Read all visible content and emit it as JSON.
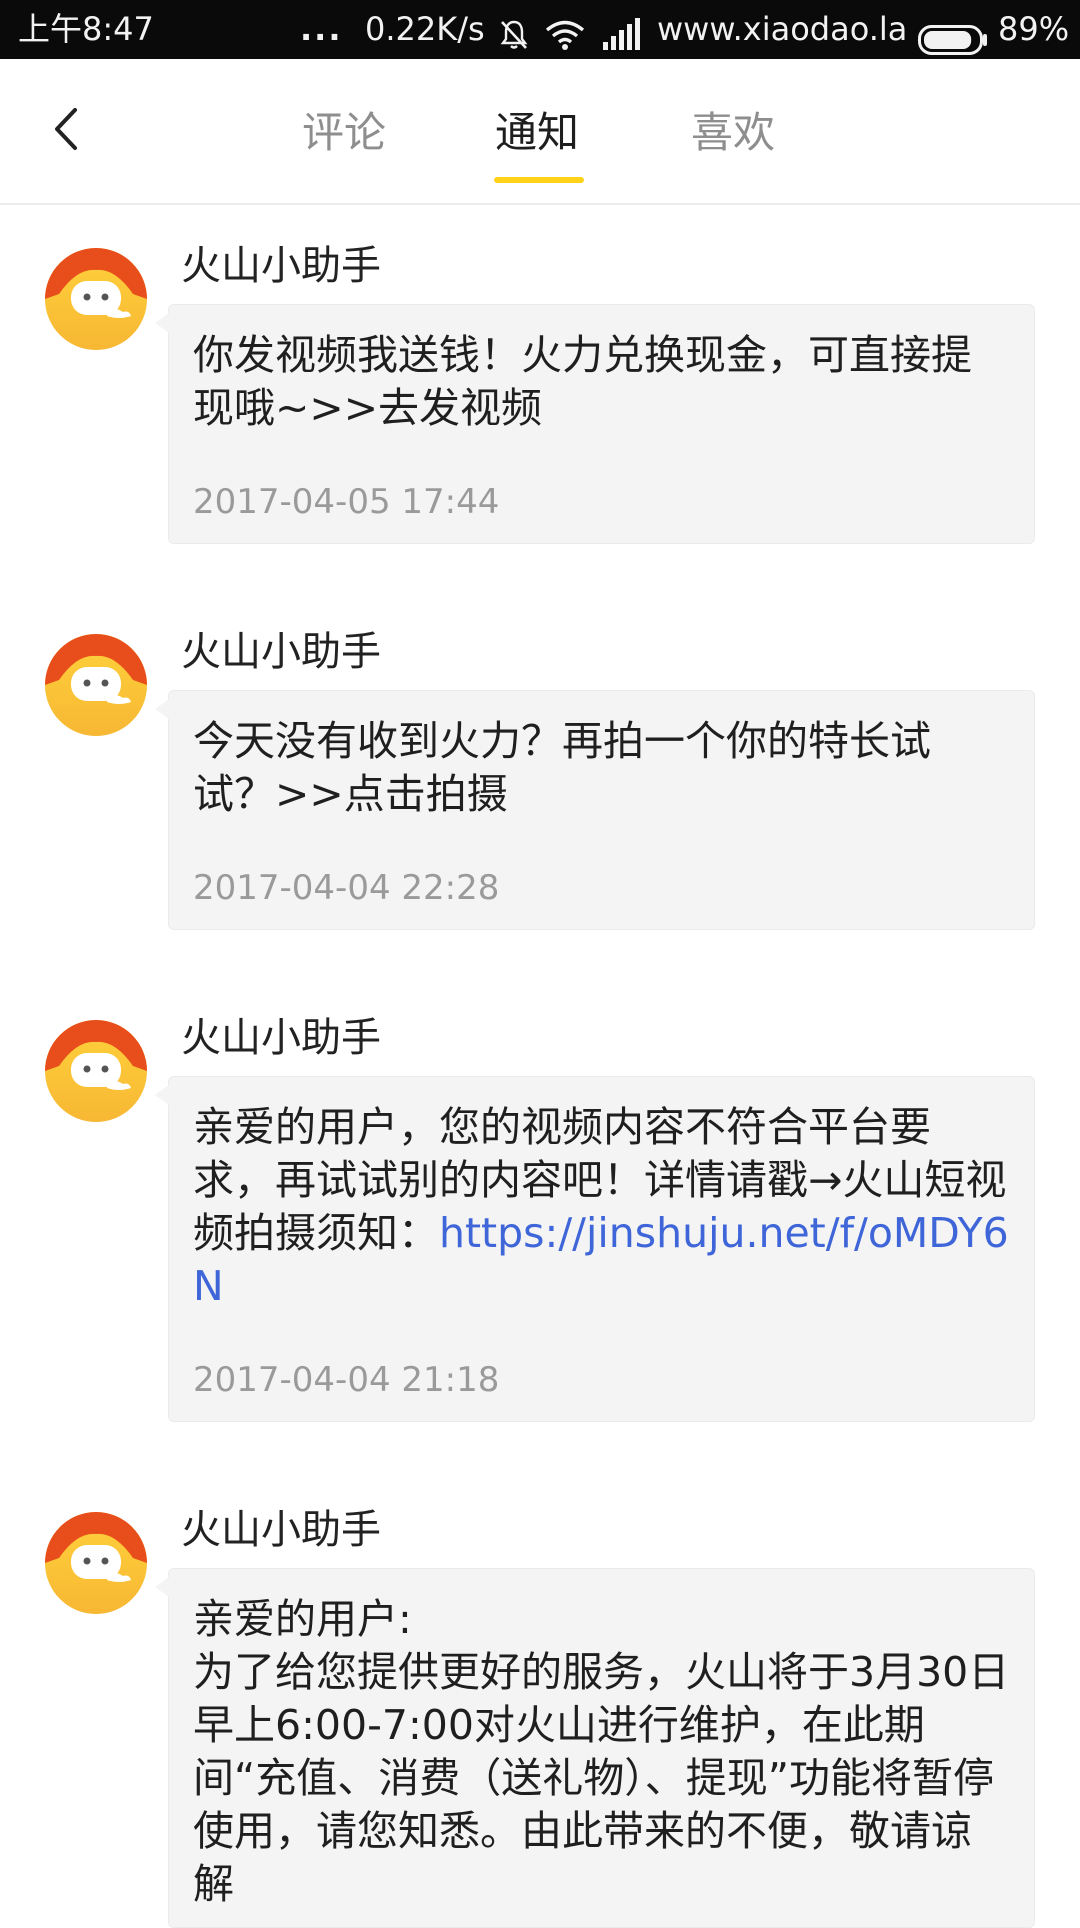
{
  "status_bar": {
    "time": "上午8:47",
    "dots": "...",
    "speed": "0.22K/s",
    "url": "www.xiaodao.la",
    "battery_percent": "89%",
    "battery_level": 0.89,
    "icons": [
      "bell-mute-icon",
      "wifi-icon",
      "signal-icon",
      "battery-icon"
    ]
  },
  "header": {
    "back_icon": "chevron-left-icon",
    "tabs": [
      {
        "label": "评论",
        "active": false
      },
      {
        "label": "通知",
        "active": true
      },
      {
        "label": "喜欢",
        "active": false
      }
    ],
    "accent_color": "#ffd21a"
  },
  "messages": [
    {
      "sender": "火山小助手",
      "text": "你发视频我送钱！火力兑换现金，可直接提现哦~>>去发视频",
      "time": "2017-04-05 17:44"
    },
    {
      "sender": "火山小助手",
      "text": "今天没有收到火力？再拍一个你的特长试试？>>点击拍摄",
      "time": "2017-04-04 22:28"
    },
    {
      "sender": "火山小助手",
      "text": "亲爱的用户，您的视频内容不符合平台要求，再试试别的内容吧！详情请戳→火山短视频拍摄须知：",
      "link": "https://jinshuju.net/f/oMDY6N",
      "time": "2017-04-04 21:18"
    },
    {
      "sender": "火山小助手",
      "text": "亲爱的用户:\n为了给您提供更好的服务，火山将于3月30日早上6:00-7:00对火山进行维护，在此期间“充值、消费（送礼物）、提现”功能将暂停使用，请您知悉。由此带来的不便，敬请谅解"
    }
  ]
}
